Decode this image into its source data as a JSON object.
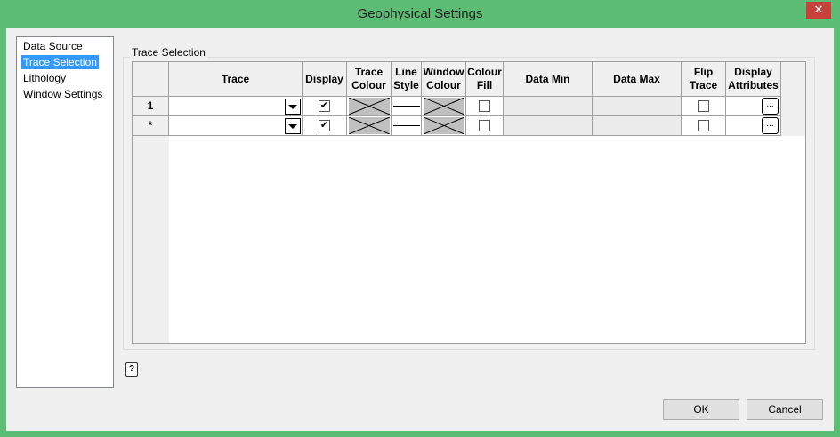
{
  "window": {
    "title": "Geophysical Settings",
    "close": "✕"
  },
  "nav": {
    "items": [
      {
        "label": "Data Source"
      },
      {
        "label": "Trace Selection",
        "selected": true
      },
      {
        "label": "Lithology"
      },
      {
        "label": "Window Settings"
      }
    ]
  },
  "group": {
    "label": "Trace Selection"
  },
  "grid": {
    "headers": [
      "Trace",
      "Display",
      "Trace Colour",
      "Line Style",
      "Window Colour",
      "Colour Fill",
      "Data Min",
      "Data Max",
      "Flip Trace",
      "Display Attributes"
    ],
    "rows": [
      {
        "row_header": "1",
        "trace": "",
        "display": true,
        "colour_fill": false,
        "data_min": "",
        "data_max": "",
        "flip_trace": false,
        "attr_button": "..."
      },
      {
        "row_header": "*",
        "trace": "",
        "display": true,
        "colour_fill": false,
        "data_min": "",
        "data_max": "",
        "flip_trace": false,
        "attr_button": "..."
      }
    ]
  },
  "help": {
    "label": "?"
  },
  "buttons": {
    "ok": "OK",
    "cancel": "Cancel"
  }
}
